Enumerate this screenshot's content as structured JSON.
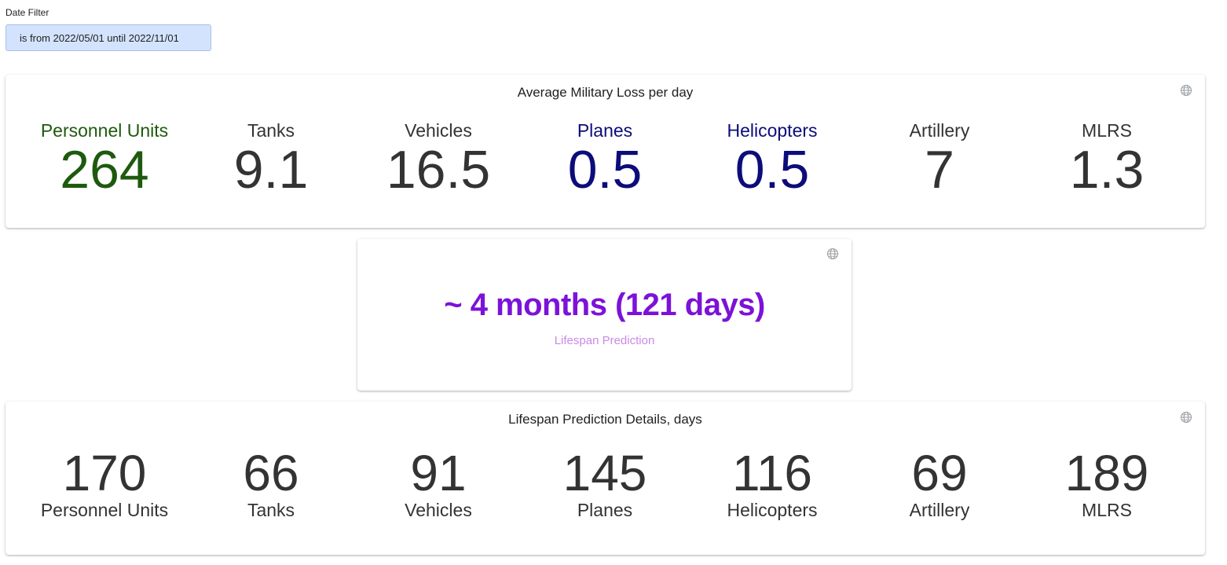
{
  "filter": {
    "label": "Date Filter",
    "value": "is from 2022/05/01 until 2022/11/01"
  },
  "loss_card": {
    "title": "Average Military Loss per day",
    "icon": "globe-icon",
    "metrics": [
      {
        "label": "Personnel Units",
        "value": "264",
        "color": "#1e5a0e"
      },
      {
        "label": "Tanks",
        "value": "9.1",
        "color": "#333333"
      },
      {
        "label": "Vehicles",
        "value": "16.5",
        "color": "#333333"
      },
      {
        "label": "Planes",
        "value": "0.5",
        "color": "#0c0c7a"
      },
      {
        "label": "Helicopters",
        "value": "0.5",
        "color": "#0c0c7a"
      },
      {
        "label": "Artillery",
        "value": "7",
        "color": "#333333"
      },
      {
        "label": "MLRS",
        "value": "1.3",
        "color": "#333333"
      }
    ]
  },
  "prediction_card": {
    "value": "~ 4 months (121 days)",
    "caption": "Lifespan Prediction",
    "icon": "globe-icon",
    "value_color": "#7c12d8",
    "caption_color": "#c98ae8"
  },
  "details_card": {
    "title": "Lifespan Prediction Details, days",
    "icon": "globe-icon",
    "metrics": [
      {
        "label": "Personnel Units",
        "value": "170"
      },
      {
        "label": "Tanks",
        "value": "66"
      },
      {
        "label": "Vehicles",
        "value": "91"
      },
      {
        "label": "Planes",
        "value": "145"
      },
      {
        "label": "Helicopters",
        "value": "116"
      },
      {
        "label": "Artillery",
        "value": "69"
      },
      {
        "label": "MLRS",
        "value": "189"
      }
    ]
  }
}
